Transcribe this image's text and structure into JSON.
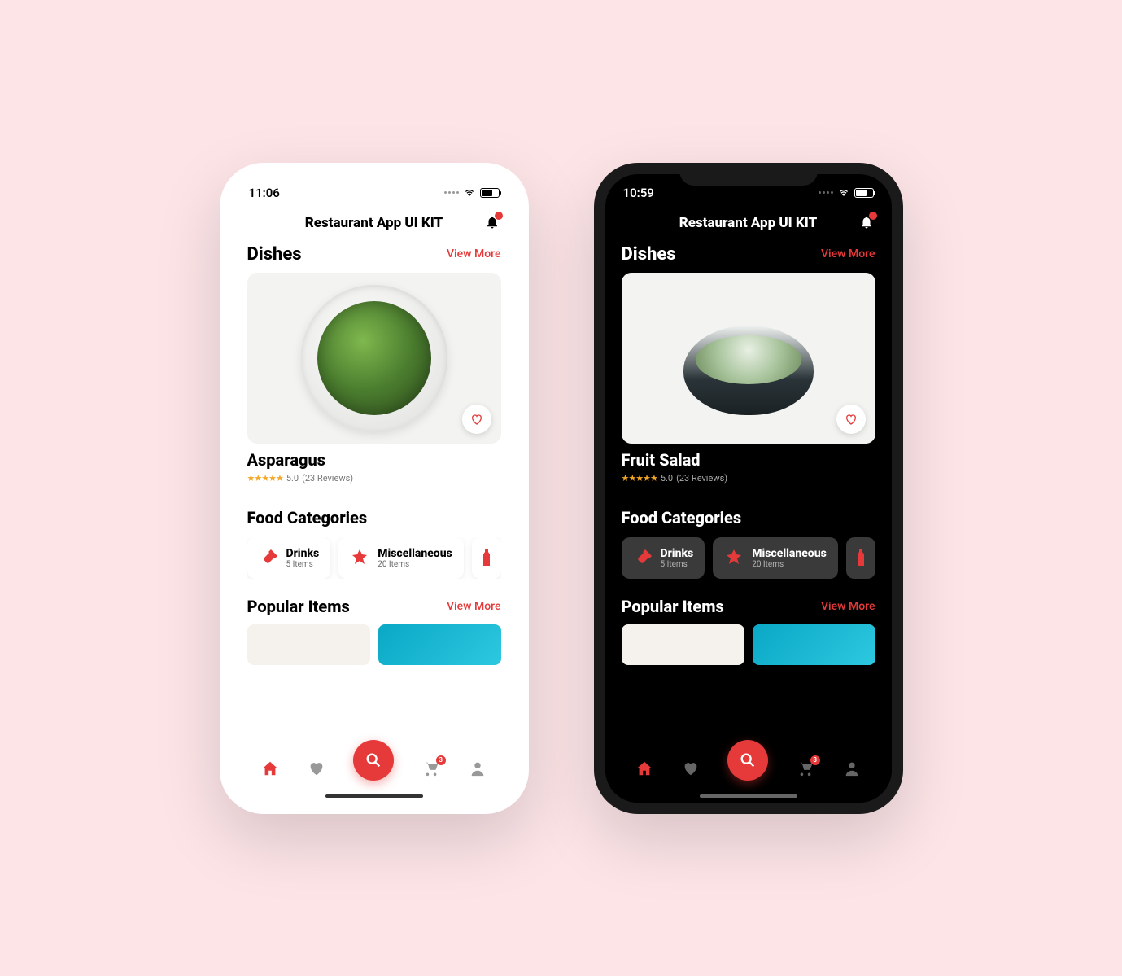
{
  "light": {
    "status_time": "11:06",
    "app_title": "Restaurant App UI KIT",
    "dishes_title": "Dishes",
    "view_more": "View More",
    "dish_name": "Asparagus",
    "rating_value": "5.0",
    "rating_reviews": "(23 Reviews)",
    "categories_title": "Food Categories",
    "cat1_name": "Drinks",
    "cat1_count": "5 Items",
    "cat2_name": "Miscellaneous",
    "cat2_count": "20 Items",
    "popular_title": "Popular Items",
    "cart_badge": "3"
  },
  "dark": {
    "status_time": "10:59",
    "app_title": "Restaurant App UI KIT",
    "dishes_title": "Dishes",
    "view_more": "View More",
    "dish_name": "Fruit Salad",
    "rating_value": "5.0",
    "rating_reviews": "(23 Reviews)",
    "categories_title": "Food Categories",
    "cat1_name": "Drinks",
    "cat1_count": "5 Items",
    "cat2_name": "Miscellaneous",
    "cat2_count": "20 Items",
    "popular_title": "Popular Items",
    "cart_badge": "3"
  }
}
